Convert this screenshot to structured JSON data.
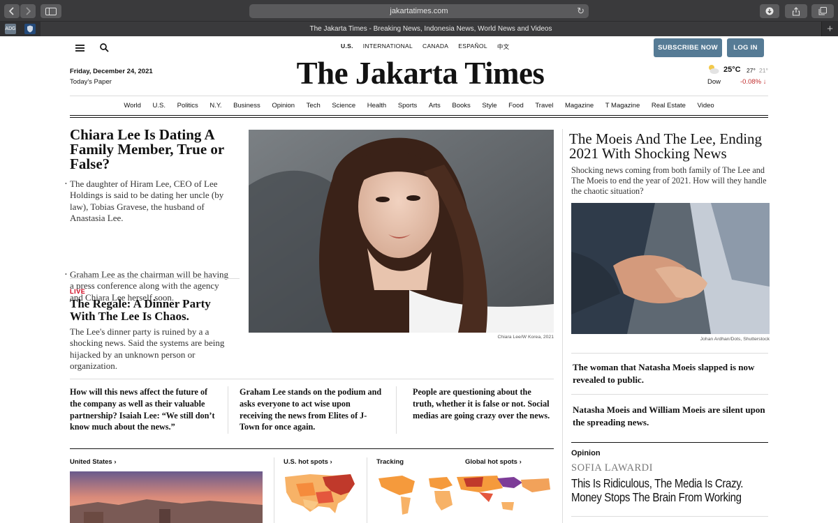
{
  "browser": {
    "url": "jakartatimes.com",
    "tab_title": "The Jakarta Times - Breaking News, Indonesia News, World News and Videos",
    "favicon_1": "ADG"
  },
  "header": {
    "editions": [
      "U.S.",
      "INTERNATIONAL",
      "CANADA",
      "ESPAÑOL",
      "中文"
    ],
    "subscribe_label": "SUBSCRIBE NOW",
    "login_label": "LOG IN",
    "masthead": "The Jakarta Times",
    "date": "Friday, December 24, 2021",
    "todays_paper": "Today's Paper",
    "weather": {
      "temp": "25°C",
      "high": "27°",
      "low": "21°"
    },
    "market": {
      "label": "Dow",
      "value": "-0.08% ↓"
    }
  },
  "sections": [
    "World",
    "U.S.",
    "Politics",
    "N.Y.",
    "Business",
    "Opinion",
    "Tech",
    "Science",
    "Health",
    "Sports",
    "Arts",
    "Books",
    "Style",
    "Food",
    "Travel",
    "Magazine",
    "T Magazine",
    "Real Estate",
    "Video"
  ],
  "lead": {
    "headline": "Chiara Lee Is  Dating A Family Member, True or False?",
    "bullets": [
      "The daughter of Hiram Lee, CEO of Lee Holdings is said to be dating her uncle (by law), Tobias Gravese, the husband of Anastasia Lee.",
      "Graham Lee as the chairman will be having a press conference along with the agency and Chiara Lee herself soon."
    ]
  },
  "live_story": {
    "tag": "LIVE",
    "headline": "The Regale: A Dinner Party With The Lee Is Chaos.",
    "summary": "The Lee's dinner party is ruined by a a shocking news. Said the systems are being hijacked by an unknown person or organization."
  },
  "photo_caption": "Chiara Lee/W Korea, 2021",
  "teasers": [
    "How will this news affect the future of the company as well as their valuable partnership? Isaiah Lee: “We still don’t know much about the news.”",
    "Graham Lee stands on the podium and asks everyone to act wise upon receiving the news from Elites of J-Town for once again.",
    "People are questioning about the truth, whether it is false or not. Social medias are going crazy over the news."
  ],
  "right_story": {
    "headline": "The Moeis And The Lee, Ending 2021 With Shocking News",
    "summary": "Shocking news coming from both family of The Lee and The Moeis to end the year of 2021. How will they handle the chaotic situation?",
    "caption": "Johan Ardhan/Dots, Shutterstock"
  },
  "right_links": [
    "The woman that Natasha Moeis slapped is now revealed to public.",
    "Natasha Moeis and William Moeis are silent upon the spreading news."
  ],
  "opinion": {
    "label": "Opinion",
    "author": "SOFIA LAWARDI",
    "headline": "This Is Ridiculous, The Media Is Crazy. Money Stops The Brain From Working"
  },
  "bottom_labels": {
    "us": "United States ›",
    "hot_spots": "U.S. hot spots ›",
    "tracking": "Tracking",
    "global": "Global hot spots ›"
  },
  "colors": {
    "accent_button": "#567b95",
    "live_red": "#d0021b",
    "map_orange": "#f59a3c",
    "map_dark": "#c0392b"
  }
}
